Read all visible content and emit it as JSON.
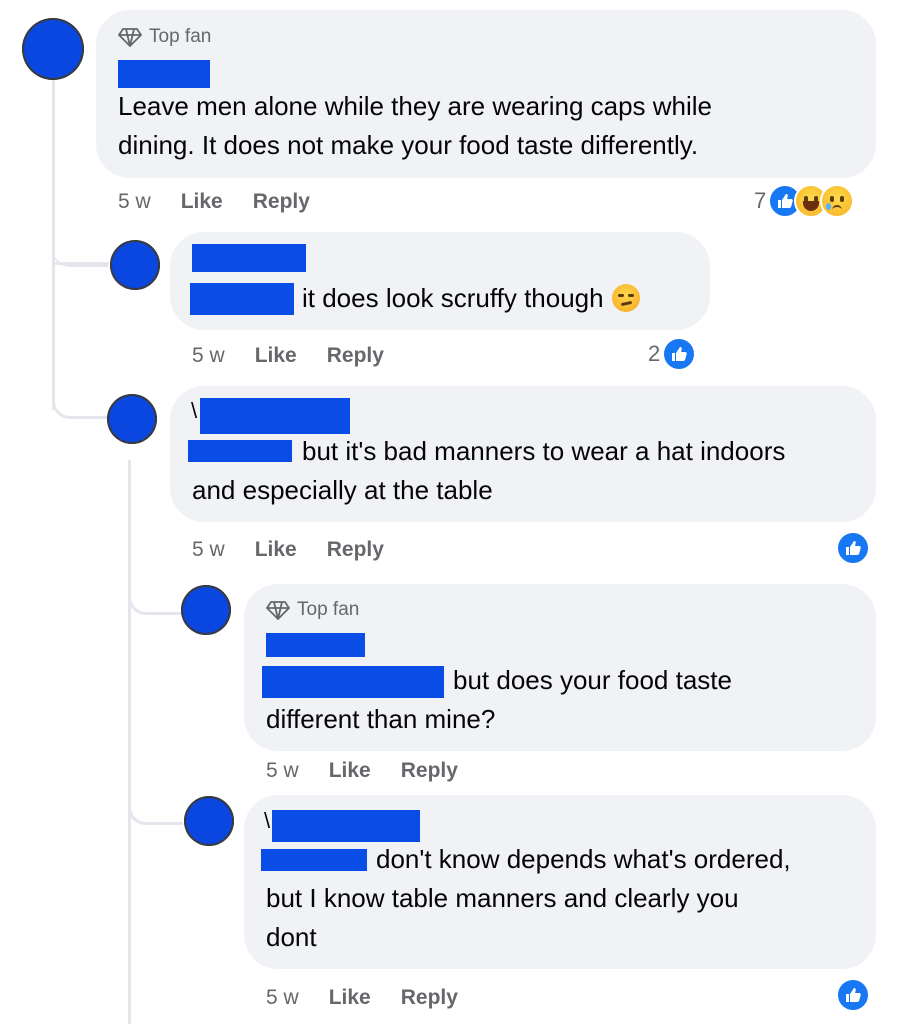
{
  "comments": [
    {
      "badge": "Top fan",
      "text_lines": [
        "Leave men alone while they are wearing caps while",
        "dining. It does not make your food taste differently."
      ],
      "time": "5 w",
      "like": "Like",
      "reply": "Reply",
      "reaction_count": "7",
      "reaction_icons": [
        "like-icon",
        "haha-icon",
        "sad-icon"
      ]
    },
    {
      "text_lines": [
        "it does look scruffy though"
      ],
      "emoji": "smirk-emoji",
      "time": "5 w",
      "like": "Like",
      "reply": "Reply",
      "reaction_count": "2",
      "reaction_icons": [
        "like-icon"
      ]
    },
    {
      "prefix": "\\",
      "text_lines": [
        "but it's bad manners to wear a hat indoors",
        "and especially at the table"
      ],
      "time": "5 w",
      "like": "Like",
      "reply": "Reply",
      "reaction_icons": [
        "like-icon"
      ]
    },
    {
      "badge": "Top fan",
      "text_lines": [
        "but does your food taste",
        "different than mine?"
      ],
      "time": "5 w",
      "like": "Like",
      "reply": "Reply"
    },
    {
      "prefix": "\\",
      "text_lines": [
        "don't know depends what's ordered,",
        "but I know table manners and clearly you",
        "dont"
      ],
      "time": "5 w",
      "like": "Like",
      "reply": "Reply",
      "reaction_icons": [
        "like-icon"
      ]
    }
  ],
  "colors": {
    "redaction": "#0a4de6",
    "bubble": "#f0f2f5",
    "like": "#1877f2",
    "meta": "#65676b"
  }
}
